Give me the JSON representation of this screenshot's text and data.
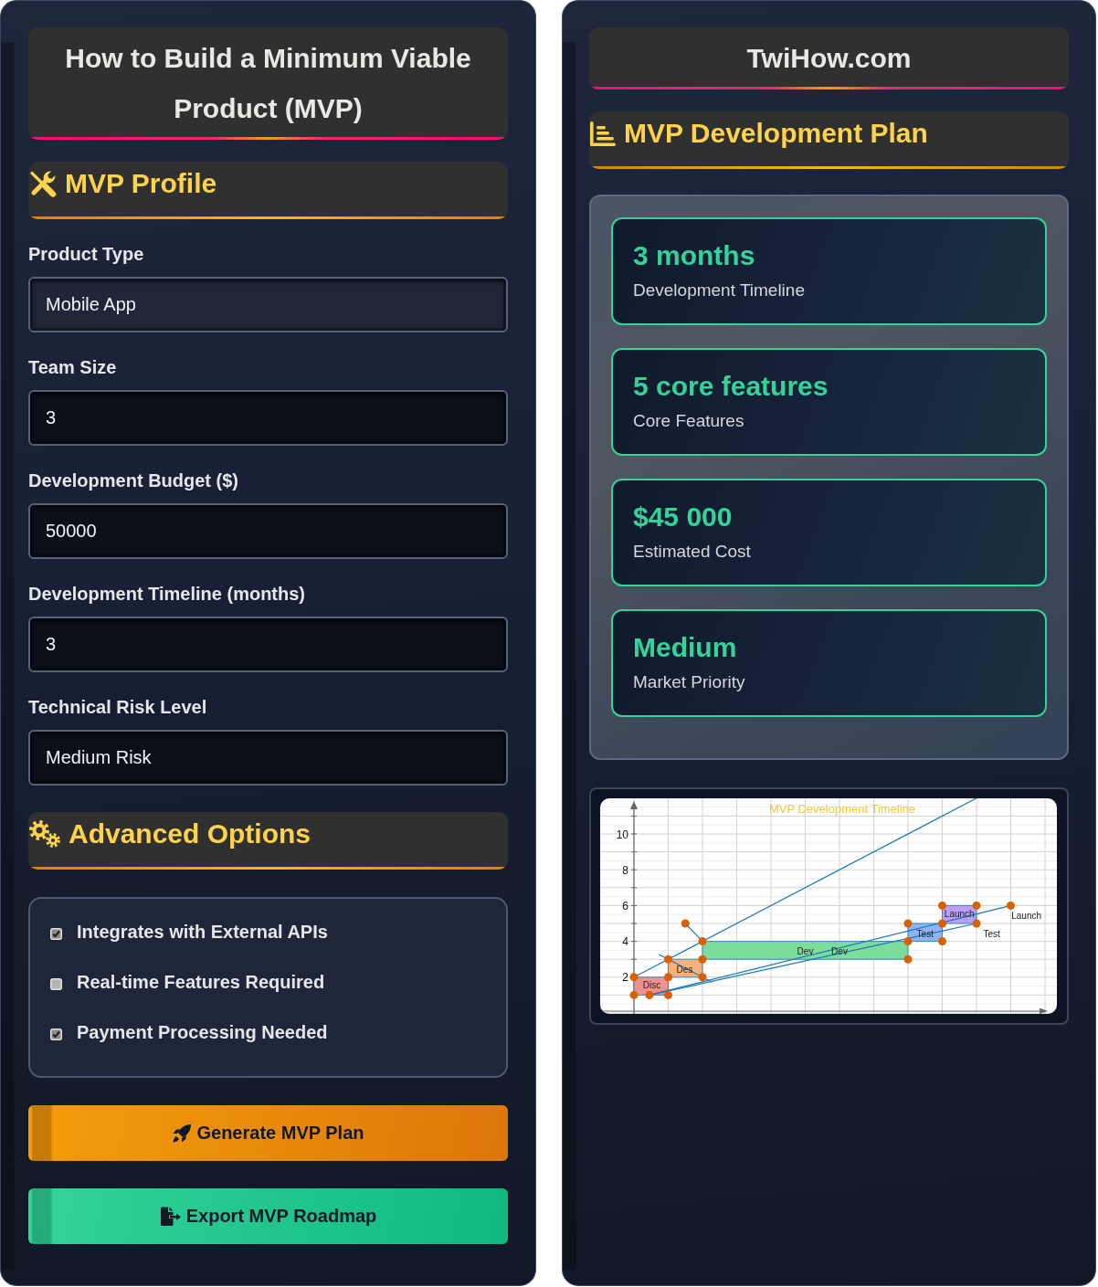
{
  "left_panel": {
    "title": "How to Build a Minimum Viable Product (MVP)",
    "profile_section": {
      "title": "MVP Profile"
    },
    "fields": [
      {
        "label": "Product Type",
        "value": "Mobile App",
        "focused": true
      },
      {
        "label": "Team Size",
        "value": "3",
        "focused": false
      },
      {
        "label": "Development Budget ($)",
        "value": "50000",
        "focused": false
      },
      {
        "label": "Development Timeline (months)",
        "value": "3",
        "focused": false
      },
      {
        "label": "Technical Risk Level",
        "value": "Medium Risk",
        "focused": false
      }
    ],
    "advanced_section": {
      "title": "Advanced Options"
    },
    "options": [
      {
        "label": "Integrates with External APIs",
        "checked": true
      },
      {
        "label": "Real-time Features Required",
        "checked": false
      },
      {
        "label": "Payment Processing Needed",
        "checked": true
      }
    ],
    "buttons": [
      {
        "kind": "generate",
        "label": "Generate MVP Plan"
      },
      {
        "kind": "export",
        "label": "Export MVP Roadmap"
      }
    ]
  },
  "right_panel": {
    "site_title": "TwiHow.com",
    "plan_section": {
      "title": "MVP Development Plan"
    },
    "results": [
      {
        "value": "3 months",
        "label": "Development Timeline"
      },
      {
        "value": "5 core features",
        "label": "Core Features"
      },
      {
        "value": "$45 000",
        "label": "Estimated Cost"
      },
      {
        "value": "Medium",
        "label": "Market Priority"
      }
    ],
    "timeline_chart": {
      "title": "MVP Development Timeline",
      "y_tick_labels": [
        "10",
        "8",
        "6",
        "4",
        "2"
      ],
      "phases": [
        {
          "labels": [
            "Disc"
          ],
          "color": "#f28f8f"
        },
        {
          "labels": [
            "Des"
          ],
          "color": "#fbb07c"
        },
        {
          "labels": [
            "Dev",
            "Dev"
          ],
          "color": "#7ddc9c"
        },
        {
          "labels": [
            "Test"
          ],
          "color": "#8fb4f6"
        },
        {
          "labels": [
            "Launch"
          ],
          "color": "#b8a0f8"
        }
      ],
      "side_labels": [
        "Test",
        "Launch"
      ]
    }
  }
}
